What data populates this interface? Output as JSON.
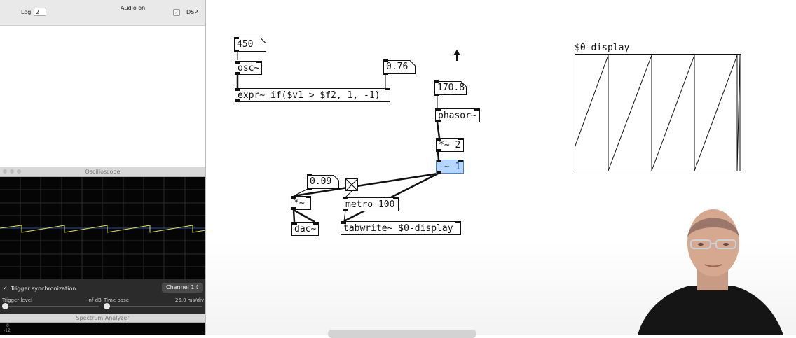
{
  "main_window": {
    "log_label": "Log:",
    "log_value": "2",
    "audio_status": "Audio on",
    "dsp_label": "DSP"
  },
  "oscilloscope": {
    "title": "Oscilloscope",
    "trigger_sync_label": "Trigger synchronization",
    "channel": "Channel 1",
    "trigger_level_label": "Trigger level",
    "trigger_level_value": "-inf dB",
    "time_base_label": "Time base",
    "time_base_value": "25.0 ms/div",
    "trace_color": "#dede5a"
  },
  "spectrum_analyzer": {
    "title": "Spectrum Analyzer",
    "scale_top": "0",
    "scale_second": "-12"
  },
  "patch": {
    "objects": {
      "num_450": "450",
      "osc": "osc~",
      "num_076": "0.76",
      "expr": "expr~ if($v1 > $f2, 1, -1)",
      "num_1708": "170.8",
      "phasor": "phasor~",
      "mul2": "*~ 2",
      "sub1": "-~ 1",
      "num_009": "0.09",
      "mul": "*~",
      "metro": "metro 100",
      "dac": "dac~",
      "tabwrite": "tabwrite~ $0-display"
    },
    "array_name": "$0-display",
    "selection_color": "#b7d6ff"
  }
}
